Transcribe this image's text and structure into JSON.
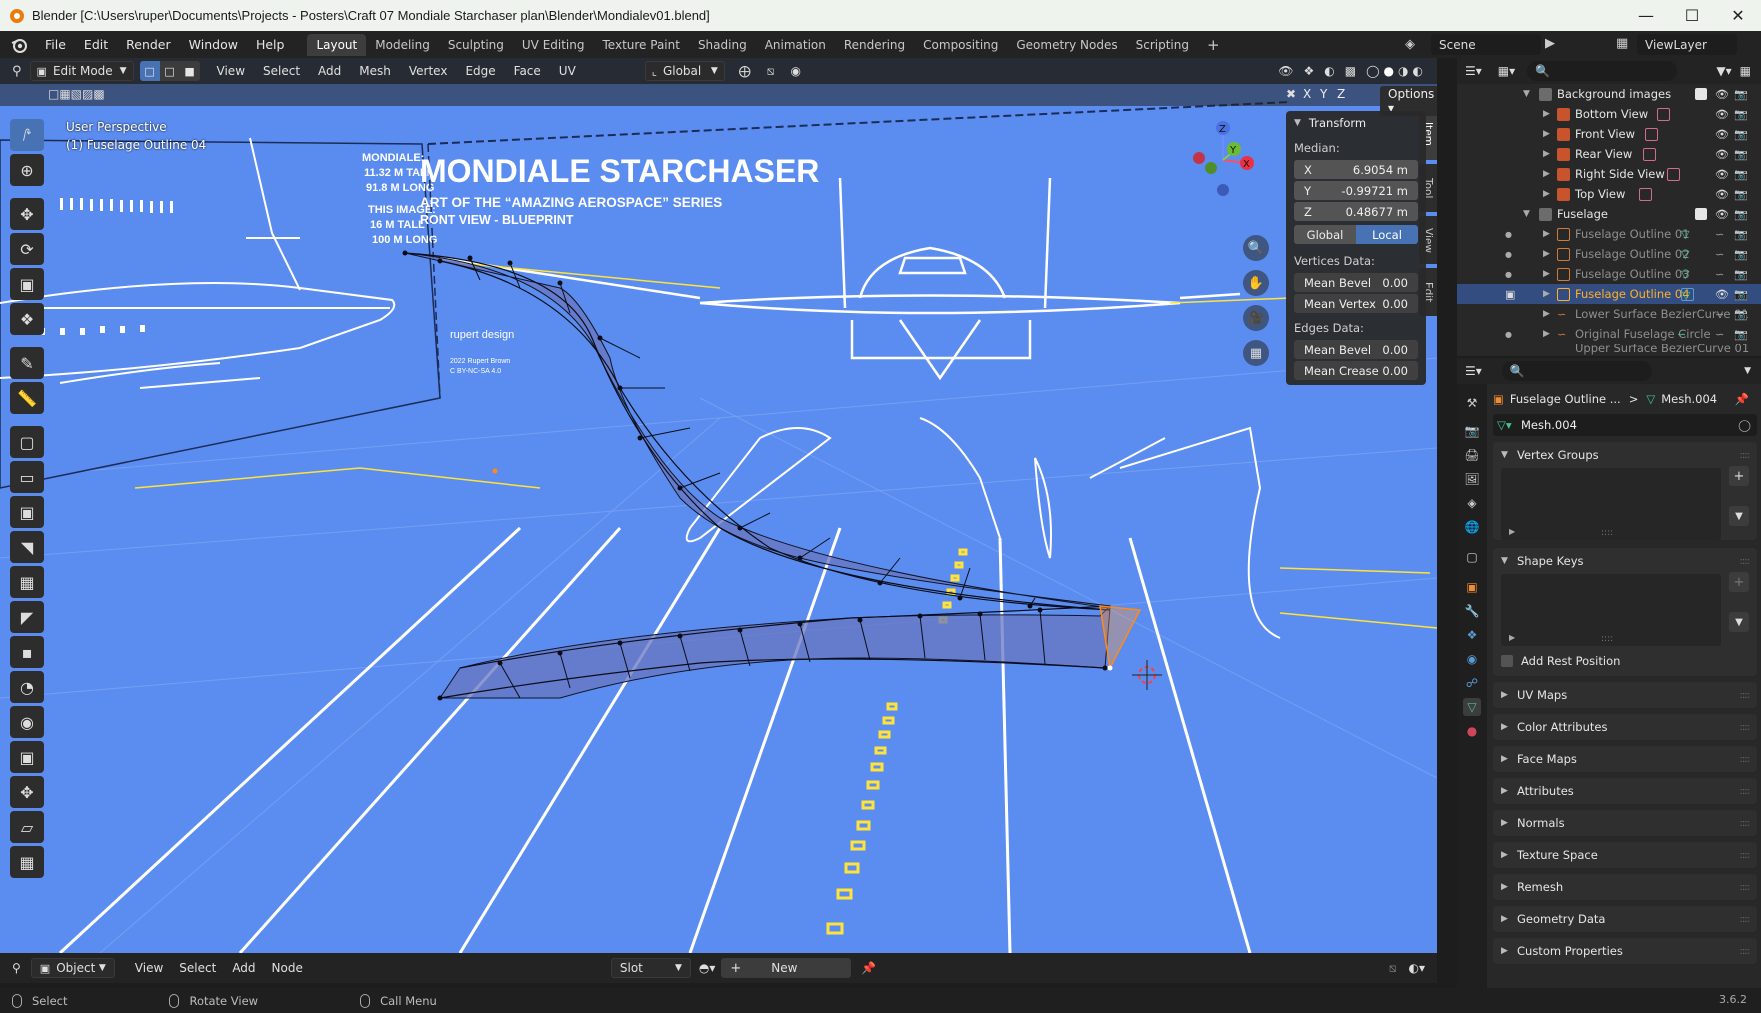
{
  "window": {
    "title": "Blender [C:\\Users\\ruper\\Documents\\Projects - Posters\\Craft 07 Mondiale Starchaser plan\\Blender\\Mondialev01.blend]"
  },
  "menu": {
    "items": [
      "File",
      "Edit",
      "Render",
      "Window",
      "Help"
    ],
    "workspaces": [
      "Layout",
      "Modeling",
      "Sculpting",
      "UV Editing",
      "Texture Paint",
      "Shading",
      "Animation",
      "Rendering",
      "Compositing",
      "Geometry Nodes",
      "Scripting"
    ],
    "active_workspace": "Layout",
    "add_tab": "+",
    "scene": "Scene",
    "view_layer": "ViewLayer"
  },
  "viewport": {
    "mode": "Edit Mode",
    "menus": [
      "View",
      "Select",
      "Add",
      "Mesh",
      "Vertex",
      "Edge",
      "Face",
      "UV"
    ],
    "orientation": "Global",
    "axes": [
      "X",
      "Y",
      "Z"
    ],
    "options_label": "Options",
    "info_line1": "User Perspective",
    "info_line2": "(1) Fuselage Outline 04",
    "gizmo_axes": [
      "Z",
      "Y",
      "X"
    ]
  },
  "blueprint": {
    "title": "MONDIALE STARCHASER",
    "subtitle1": "ART OF THE “AMAZING AEROSPACE” SERIES",
    "subtitle2": "RONT VIEW - BLUEPRINT",
    "spec_lines": [
      "MONDIALE:",
      "11.32 M TALL",
      "91.8 M LONG",
      "THIS IMAGE:",
      "16 M TALL",
      "100 M LONG"
    ],
    "brand": "rupert design",
    "copyright": "2022 Rupert Brown",
    "license": "C BY-NC-SA 4.0"
  },
  "transform_panel": {
    "header": "Transform",
    "median_label": "Median:",
    "x_label": "X",
    "x_value": "6.9054 m",
    "y_label": "Y",
    "y_value": "-0.99721 m",
    "z_label": "Z",
    "z_value": "0.48677 m",
    "global_label": "Global",
    "local_label": "Local",
    "vertices_label": "Vertices Data:",
    "mean_bevel_label": "Mean Bevel",
    "mean_bevel_value": "0.00",
    "mean_vertex_label": "Mean Vertex",
    "mean_vertex_value": "0.00",
    "edges_label": "Edges Data:",
    "edge_bevel_label": "Mean Bevel",
    "edge_bevel_value": "0.00",
    "mean_crease_label": "Mean Crease",
    "mean_crease_value": "0.00"
  },
  "side_tabs": [
    "Item",
    "Tool",
    "View",
    "Edit"
  ],
  "bottom_editor": {
    "object_label": "Object",
    "menus": [
      "View",
      "Select",
      "Add",
      "Node"
    ],
    "slot_label": "Slot",
    "new_label": "New"
  },
  "status_bar": {
    "items": [
      "Select",
      "Rotate View",
      "Call Menu"
    ],
    "version": "3.6.2"
  },
  "outliner": {
    "rows": [
      {
        "label": "Background images",
        "kind": "collection"
      },
      {
        "label": "Bottom View",
        "kind": "image"
      },
      {
        "label": "Front View",
        "kind": "image"
      },
      {
        "label": "Rear View",
        "kind": "image"
      },
      {
        "label": "Right Side View",
        "kind": "image"
      },
      {
        "label": "Top View",
        "kind": "image"
      },
      {
        "label": "Fuselage",
        "kind": "collection"
      },
      {
        "label": "Fuselage Outline 01",
        "kind": "mesh"
      },
      {
        "label": "Fuselage Outline 02",
        "kind": "mesh"
      },
      {
        "label": "Fuselage Outline 03",
        "kind": "mesh"
      },
      {
        "label": "Fuselage Outline 04",
        "kind": "mesh"
      },
      {
        "label": "Lower Surface BezierCurve 01",
        "kind": "curve"
      },
      {
        "label": "Original Fuselage Circle",
        "kind": "curve"
      },
      {
        "label": "Upper Surface BezierCurve 01",
        "kind": "curve"
      }
    ]
  },
  "properties": {
    "breadcrumb_object": "Fuselage Outline ...",
    "breadcrumb_sep": ">",
    "breadcrumb_data": "Mesh.004",
    "mesh_name": "Mesh.004",
    "panels": [
      "Vertex Groups",
      "Shape Keys",
      "UV Maps",
      "Color Attributes",
      "Face Maps",
      "Attributes",
      "Normals",
      "Texture Space",
      "Remesh",
      "Geometry Data",
      "Custom Properties"
    ],
    "add_rest_position": "Add Rest Position"
  },
  "colors": {
    "viewport_bg": "#5b8df0",
    "accent": "#4772b3",
    "selected_row": "#334d80",
    "highlight_text": "#ffaf29"
  }
}
